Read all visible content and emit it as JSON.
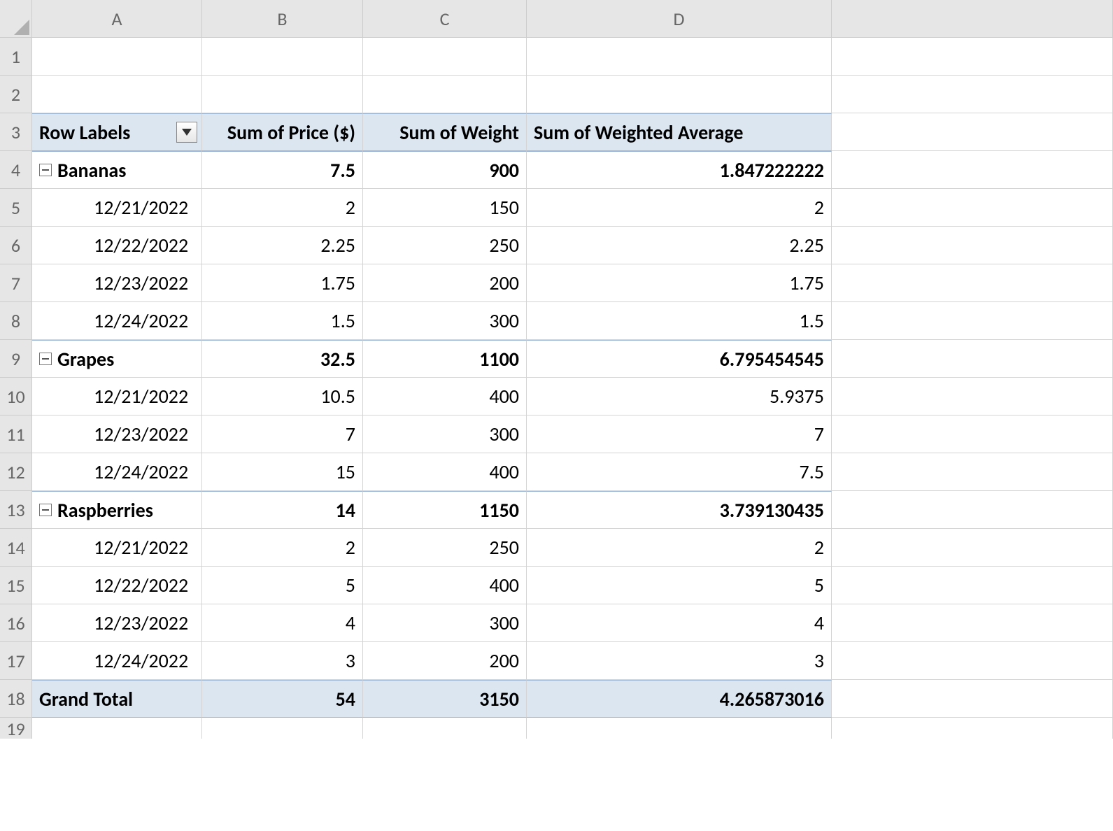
{
  "columns": [
    "A",
    "B",
    "C",
    "D"
  ],
  "row_numbers": [
    "1",
    "2",
    "3",
    "4",
    "5",
    "6",
    "7",
    "8",
    "9",
    "10",
    "11",
    "12",
    "13",
    "14",
    "15",
    "16",
    "17",
    "18"
  ],
  "partial_row_number": "19",
  "pivot": {
    "headers": {
      "row_labels": "Row Labels",
      "price": "Sum of Price ($)",
      "weight": "Sum of Weight",
      "weighted_avg": "Sum of Weighted Average"
    },
    "groups": [
      {
        "label": "Bananas",
        "price": "7.5",
        "weight": "900",
        "wavg": "1.847222222",
        "rows": [
          {
            "date": "12/21/2022",
            "price": "2",
            "weight": "150",
            "wavg": "2"
          },
          {
            "date": "12/22/2022",
            "price": "2.25",
            "weight": "250",
            "wavg": "2.25"
          },
          {
            "date": "12/23/2022",
            "price": "1.75",
            "weight": "200",
            "wavg": "1.75"
          },
          {
            "date": "12/24/2022",
            "price": "1.5",
            "weight": "300",
            "wavg": "1.5"
          }
        ]
      },
      {
        "label": "Grapes",
        "price": "32.5",
        "weight": "1100",
        "wavg": "6.795454545",
        "rows": [
          {
            "date": "12/21/2022",
            "price": "10.5",
            "weight": "400",
            "wavg": "5.9375"
          },
          {
            "date": "12/23/2022",
            "price": "7",
            "weight": "300",
            "wavg": "7"
          },
          {
            "date": "12/24/2022",
            "price": "15",
            "weight": "400",
            "wavg": "7.5"
          }
        ]
      },
      {
        "label": "Raspberries",
        "price": "14",
        "weight": "1150",
        "wavg": "3.739130435",
        "rows": [
          {
            "date": "12/21/2022",
            "price": "2",
            "weight": "250",
            "wavg": "2"
          },
          {
            "date": "12/22/2022",
            "price": "5",
            "weight": "400",
            "wavg": "5"
          },
          {
            "date": "12/23/2022",
            "price": "4",
            "weight": "300",
            "wavg": "4"
          },
          {
            "date": "12/24/2022",
            "price": "3",
            "weight": "200",
            "wavg": "3"
          }
        ]
      }
    ],
    "grand_total": {
      "label": "Grand Total",
      "price": "54",
      "weight": "3150",
      "wavg": "4.265873016"
    }
  }
}
